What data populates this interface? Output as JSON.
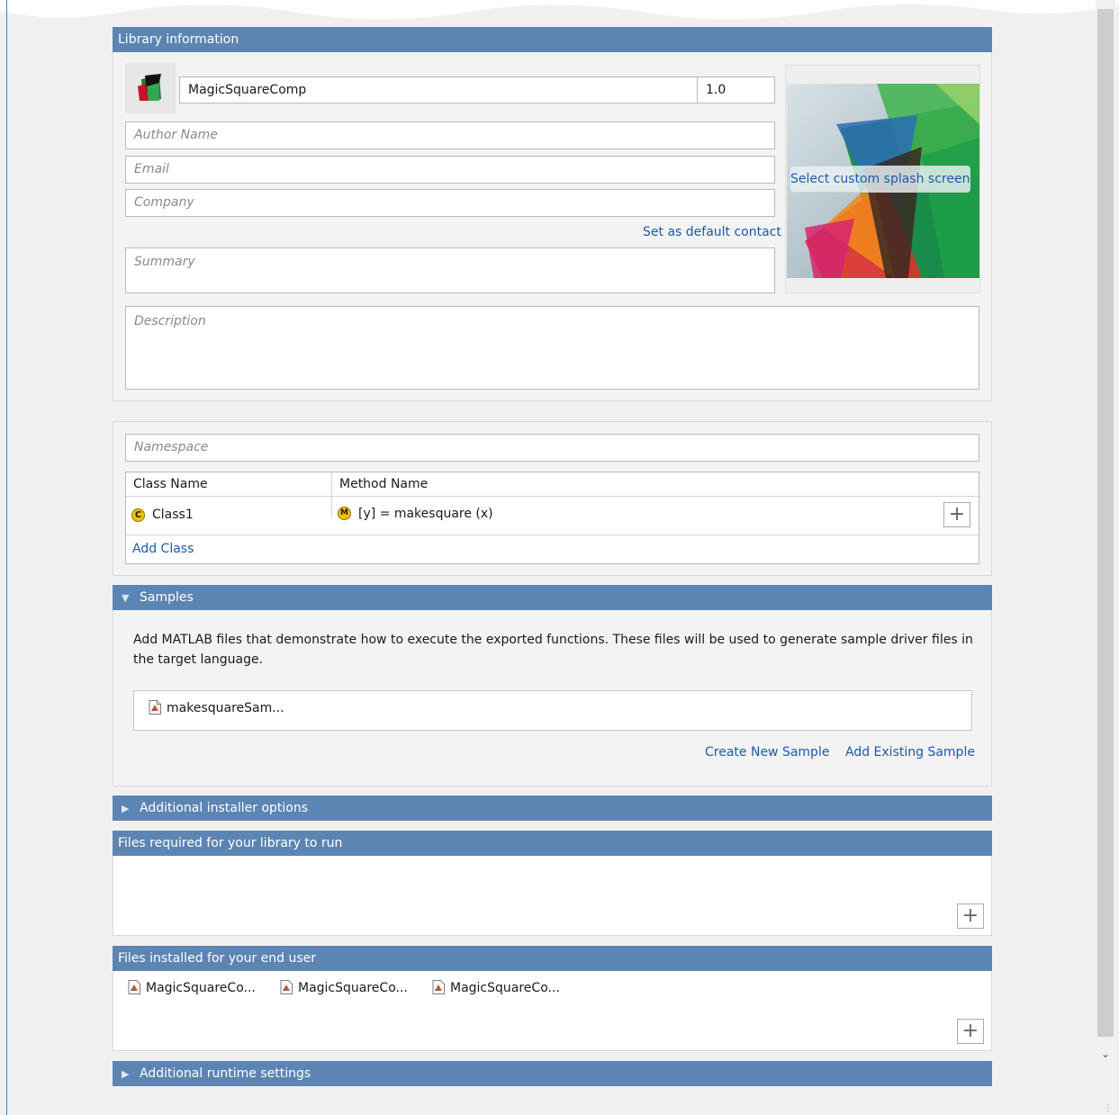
{
  "library_info": {
    "header": "Library information",
    "app_name": "MagicSquareComp",
    "version": "1.0",
    "author_placeholder": "Author Name",
    "email_placeholder": "Email",
    "company_placeholder": "Company",
    "set_default_contact": "Set as default contact",
    "summary_placeholder": "Summary",
    "description_placeholder": "Description",
    "splash_button": "Select custom splash screen"
  },
  "classes": {
    "namespace_placeholder": "Namespace",
    "columns": [
      "Class Name",
      "Method Name"
    ],
    "rows": [
      {
        "class_badge": "C",
        "class_name": "Class1",
        "method_badge": "M",
        "method": "[y] = makesquare (x)"
      }
    ],
    "add_class": "Add Class",
    "plus": "+"
  },
  "samples": {
    "header": "Samples",
    "description": "Add MATLAB files that demonstrate how to execute the exported functions.  These files will be used to generate sample driver files in the target language.",
    "files": [
      "makesquareSam..."
    ],
    "create_new": "Create New Sample",
    "add_existing": "Add Existing Sample"
  },
  "installer_options": {
    "header": "Additional installer options"
  },
  "files_required": {
    "header": "Files required for your library to run",
    "plus": "+"
  },
  "files_installed": {
    "header": "Files installed for your end user",
    "files": [
      "MagicSquareCo...",
      "MagicSquareCo...",
      "MagicSquareCo..."
    ],
    "plus": "+"
  },
  "runtime_settings": {
    "header": "Additional runtime settings"
  },
  "colors": {
    "header_bar": "#5c85b4",
    "link": "#1f5aa6",
    "badge": "#f2c200"
  }
}
